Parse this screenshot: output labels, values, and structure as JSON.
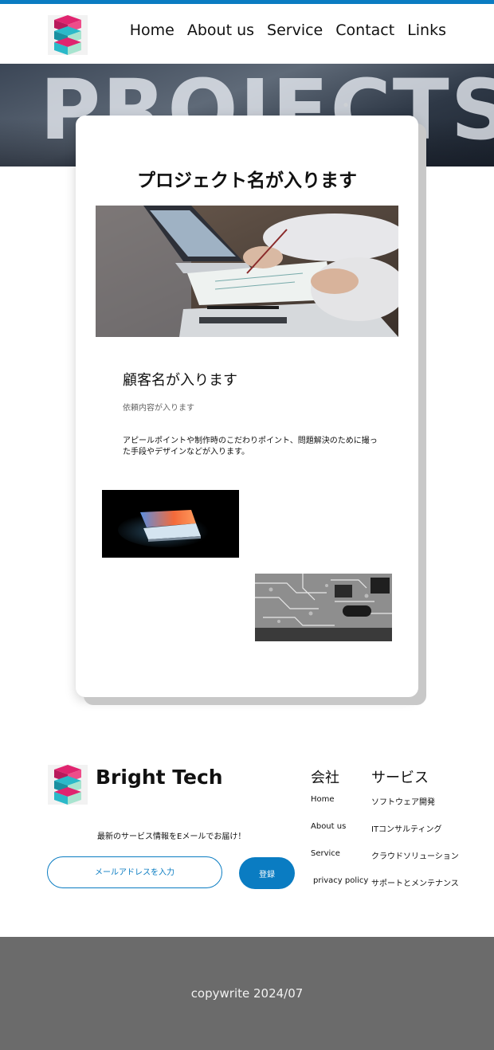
{
  "colors": {
    "accent": "#0a7cc2",
    "footer_bg": "#6b6b6b",
    "logo_pink": "#e0246f",
    "logo_teal": "#2bb9c9",
    "logo_mint": "#a8e4cf"
  },
  "header": {
    "logo_icon": "cube-logo-icon",
    "nav": [
      "Home",
      "About us",
      "Service",
      "Contact",
      "Links"
    ]
  },
  "hero": {
    "word": "PROJECTS"
  },
  "project": {
    "title": "プロジェクト名が入ります",
    "client": "顧客名が入ります",
    "request": "依頼内容が入ります",
    "appeal": "アピールポイントや制作時のこだわりポイント、問題解決のために撮った手段やデザインなどが入ります。",
    "images": [
      "office-meeting-photo",
      "glowing-laptop-photo",
      "circuit-board-photo"
    ]
  },
  "footer": {
    "brand": "Bright Tech",
    "newsletter_text": "最新のサービス情報をEメールでお届け！",
    "email_placeholder": "メールアドレスを入力",
    "subscribe_label": "登録",
    "company": {
      "heading": "会社",
      "links": [
        "Home",
        "About us",
        "Service",
        "privacy policy"
      ]
    },
    "services": {
      "heading": "サービス",
      "links": [
        "ソフトウェア開発",
        "ITコンサルティング",
        "クラウドソリューション",
        "サポートとメンテナンス"
      ]
    },
    "copyright": "copywrite 2024/07"
  }
}
